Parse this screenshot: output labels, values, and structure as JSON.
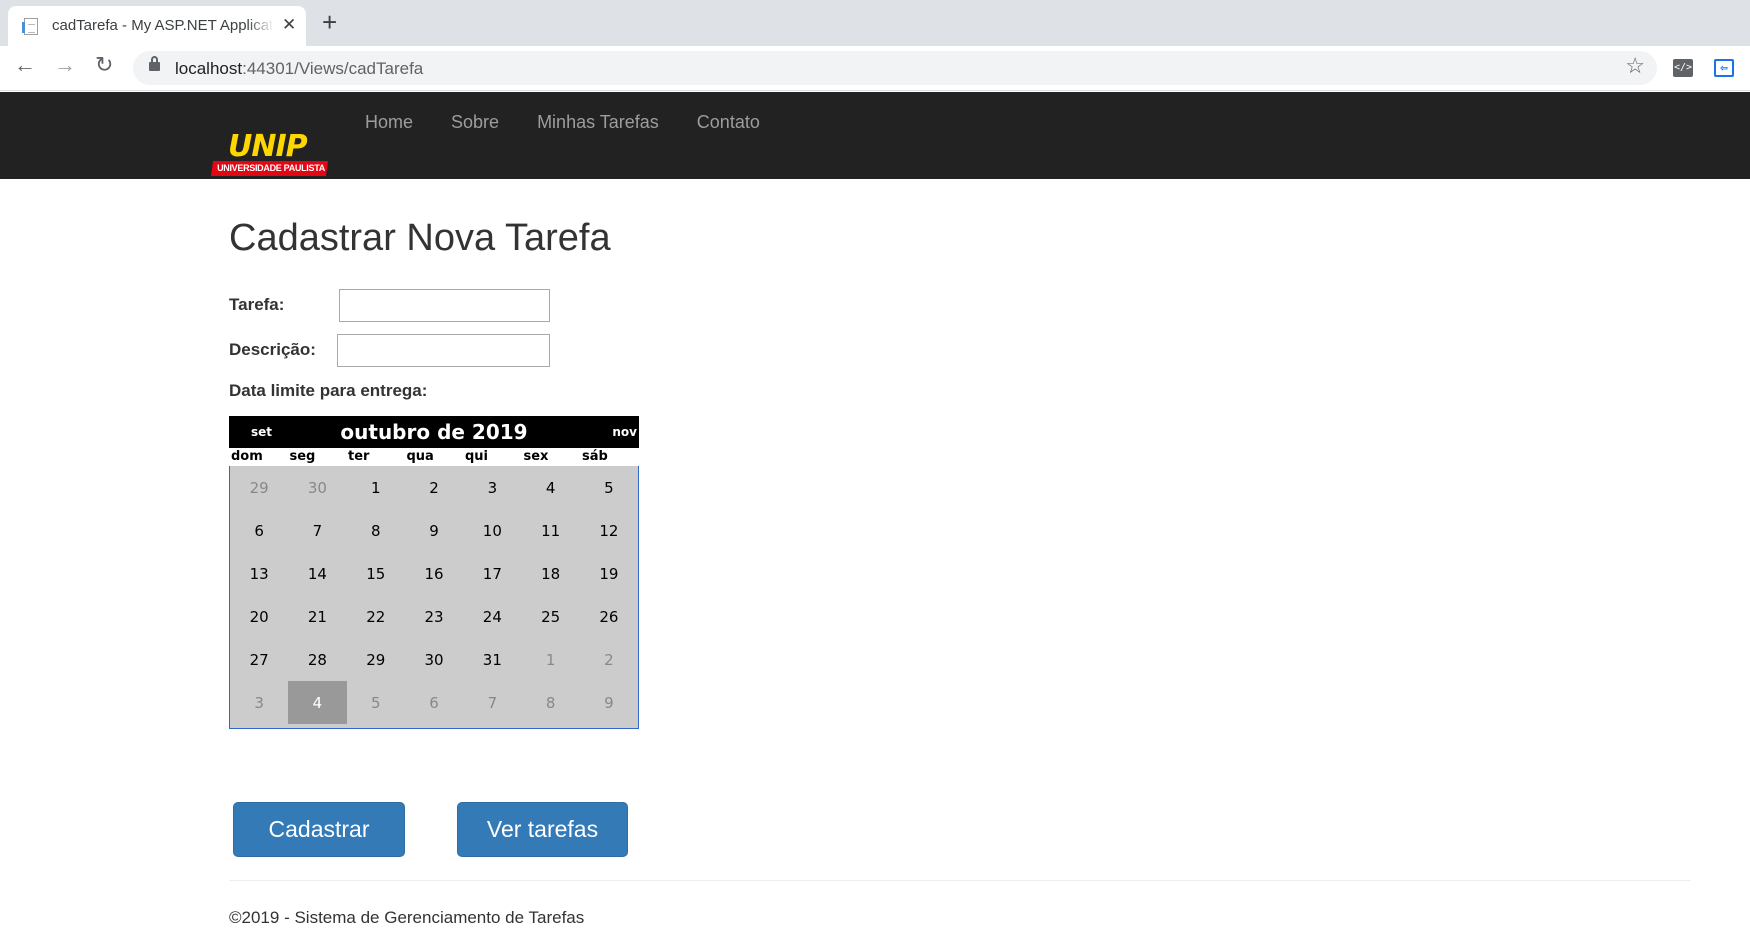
{
  "browser": {
    "tab_title": "cadTarefa - My ASP.NET Application",
    "tab_close": "✕",
    "new_tab": "+",
    "url_host": "localhost",
    "url_rest": ":44301/Views/cadTarefa",
    "star": "☆",
    "ext_devtools": "</>",
    "ext_other": "⇦"
  },
  "navbar": {
    "brand_word": "UNIP",
    "brand_sub": "UNIVERSIDADE PAULISTA",
    "links": [
      "Home",
      "Sobre",
      "Minhas Tarefas",
      "Contato"
    ]
  },
  "page": {
    "title": "Cadastrar Nova Tarefa",
    "label_tarefa": "Tarefa:",
    "label_descricao": "Descrição:",
    "label_data": "Data limite para entrega:",
    "value_tarefa": "",
    "value_descricao": ""
  },
  "calendar": {
    "prev": "set",
    "next": "nov",
    "month_label": "outubro de 2019",
    "weekdays": [
      "dom",
      "seg",
      "ter",
      "qua",
      "qui",
      "sex",
      "sáb"
    ],
    "weeks": [
      [
        {
          "d": "29",
          "o": true
        },
        {
          "d": "30",
          "o": true
        },
        {
          "d": "1"
        },
        {
          "d": "2"
        },
        {
          "d": "3"
        },
        {
          "d": "4"
        },
        {
          "d": "5"
        }
      ],
      [
        {
          "d": "6"
        },
        {
          "d": "7"
        },
        {
          "d": "8"
        },
        {
          "d": "9"
        },
        {
          "d": "10"
        },
        {
          "d": "11"
        },
        {
          "d": "12"
        }
      ],
      [
        {
          "d": "13"
        },
        {
          "d": "14"
        },
        {
          "d": "15"
        },
        {
          "d": "16"
        },
        {
          "d": "17"
        },
        {
          "d": "18"
        },
        {
          "d": "19"
        }
      ],
      [
        {
          "d": "20"
        },
        {
          "d": "21"
        },
        {
          "d": "22"
        },
        {
          "d": "23"
        },
        {
          "d": "24"
        },
        {
          "d": "25"
        },
        {
          "d": "26"
        }
      ],
      [
        {
          "d": "27"
        },
        {
          "d": "28"
        },
        {
          "d": "29"
        },
        {
          "d": "30"
        },
        {
          "d": "31"
        },
        {
          "d": "1",
          "o": true
        },
        {
          "d": "2",
          "o": true
        }
      ],
      [
        {
          "d": "3",
          "o": true
        },
        {
          "d": "4",
          "o": true,
          "s": true
        },
        {
          "d": "5",
          "o": true
        },
        {
          "d": "6",
          "o": true
        },
        {
          "d": "7",
          "o": true
        },
        {
          "d": "8",
          "o": true
        },
        {
          "d": "9",
          "o": true
        }
      ]
    ],
    "colors": {
      "header_bg": "#000000",
      "grid_bg": "#cccccc",
      "selected_bg": "#999999",
      "border": "#3366cc"
    }
  },
  "actions": {
    "cadastrar": "Cadastrar",
    "ver_tarefas": "Ver tarefas"
  },
  "footer": {
    "text": "©2019 - Sistema de Gerenciamento de Tarefas"
  },
  "colors": {
    "navbar_bg": "#222222",
    "button_bg": "#337ab7",
    "brand_yellow": "#ffd700",
    "brand_red": "#e30613"
  }
}
